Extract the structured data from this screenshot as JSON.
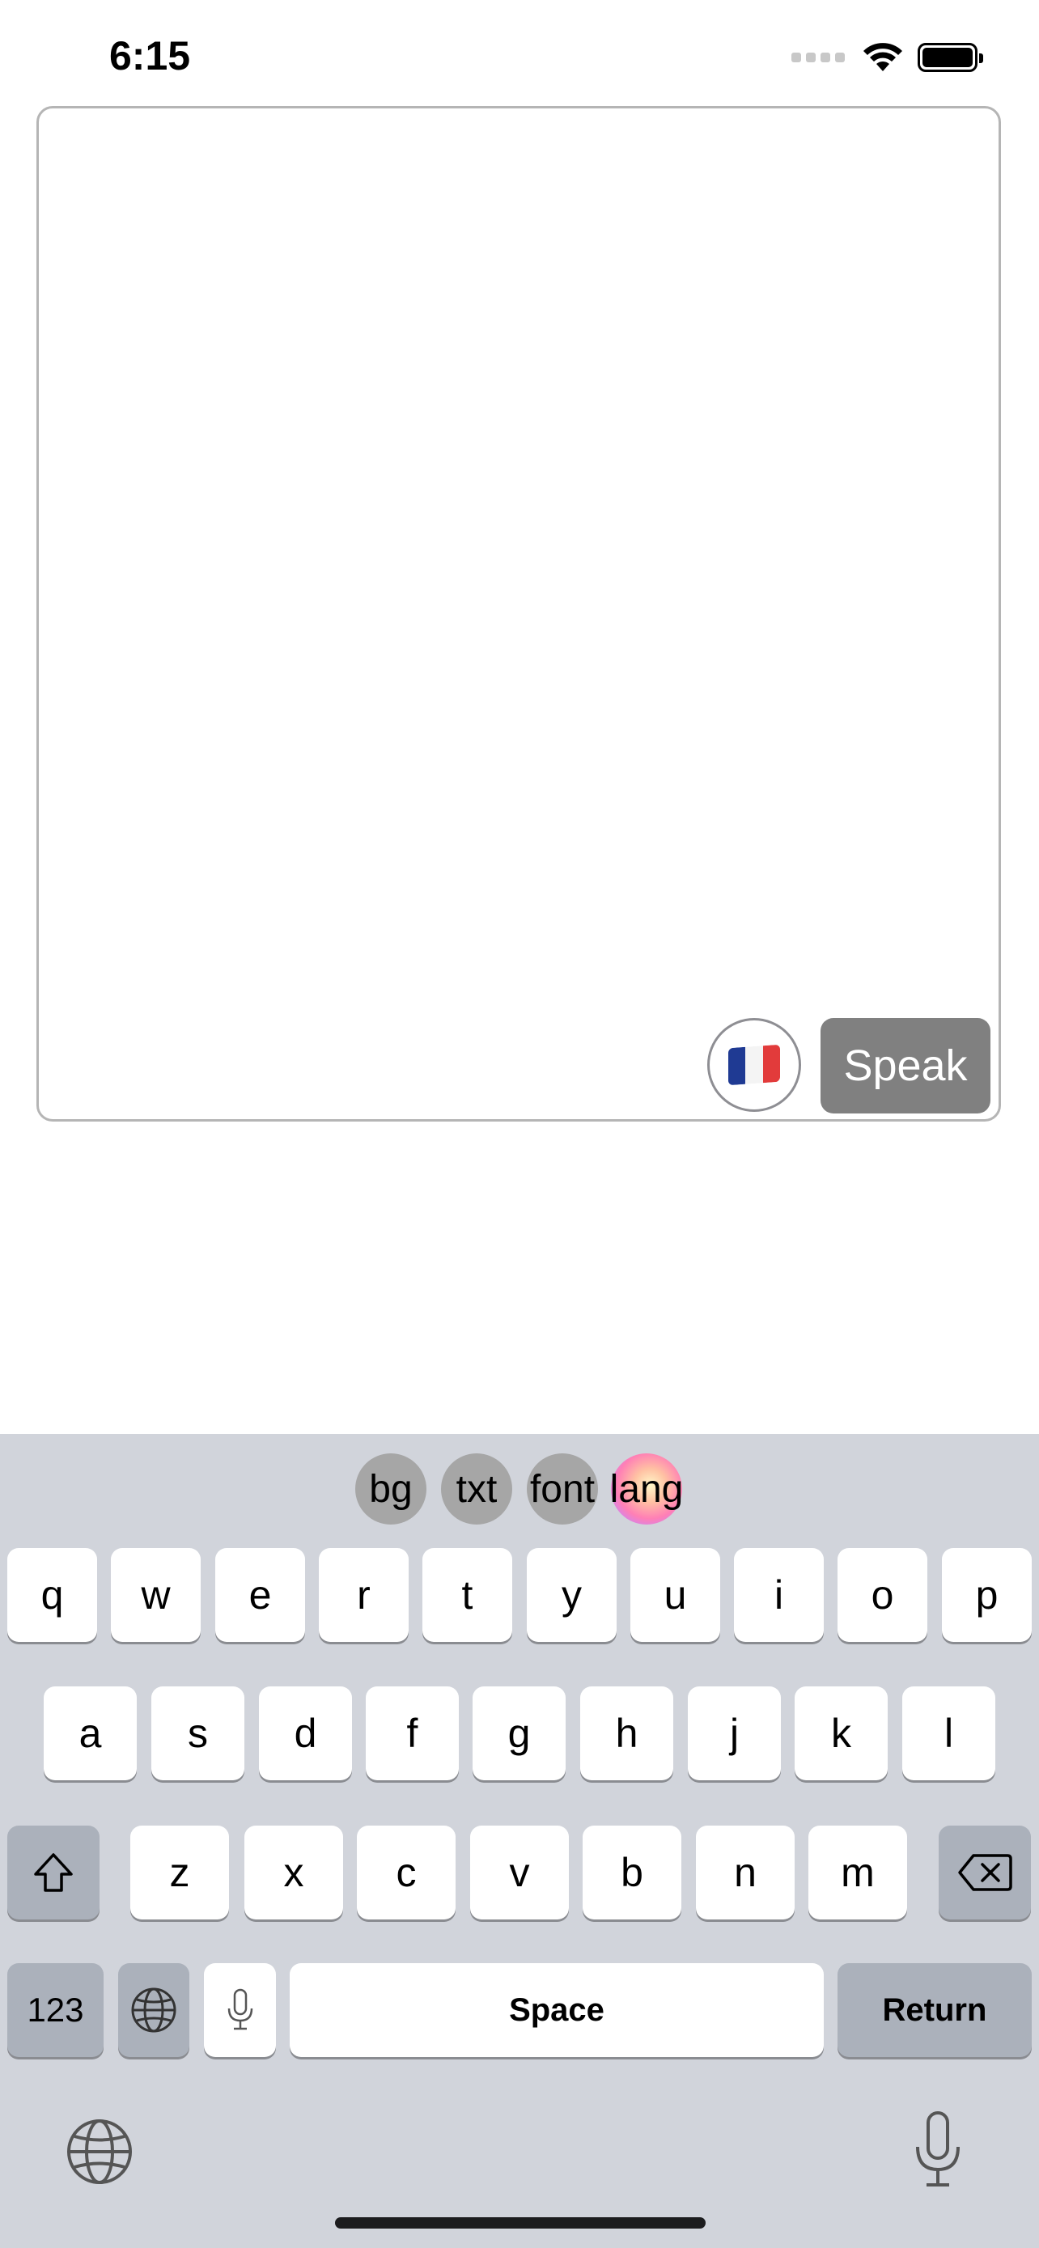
{
  "status_bar": {
    "time": "6:15",
    "signal_icon": "cellular-signal-icon",
    "wifi_icon": "wifi-icon",
    "battery_icon": "battery-icon"
  },
  "editor": {
    "text": "",
    "flag_emoji_name": "france-flag-icon",
    "speak_label": "Speak",
    "speak_color": "#808080"
  },
  "keyboard_toolbar": {
    "chips": [
      "bg",
      "txt",
      "font",
      "lang"
    ]
  },
  "keyboard": {
    "row1": [
      "q",
      "w",
      "e",
      "r",
      "t",
      "y",
      "u",
      "i",
      "o",
      "p"
    ],
    "row2": [
      "a",
      "s",
      "d",
      "f",
      "g",
      "h",
      "j",
      "k",
      "l"
    ],
    "row3": [
      "z",
      "x",
      "c",
      "v",
      "b",
      "n",
      "m"
    ],
    "numbers_label": "123",
    "space_label": "Space",
    "return_label": "Return",
    "key_color": "#ffffff",
    "special_key_color": "#abb1bb",
    "keyboard_bg": "#d1d4db"
  }
}
